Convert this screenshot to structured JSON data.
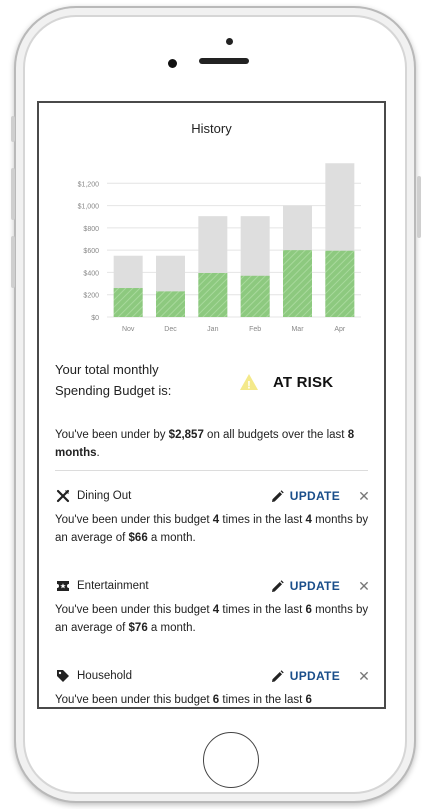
{
  "header": {
    "title": "History"
  },
  "chart_data": {
    "type": "bar",
    "categories": [
      "Nov",
      "Dec",
      "Jan",
      "Feb",
      "Mar",
      "Apr"
    ],
    "series": [
      {
        "values": [
          260,
          230,
          395,
          370,
          600,
          595
        ]
      },
      {
        "values": [
          550,
          550,
          905,
          905,
          1000,
          1380
        ]
      }
    ],
    "y_ticks": [
      "$0",
      "$200",
      "$400",
      "$600",
      "$800",
      "$1,000",
      "$1,200"
    ],
    "ylim": [
      0,
      1400
    ],
    "stacked": false,
    "grid": true,
    "colors": {
      "spent": "#8dc97f",
      "budget": "#dedede"
    }
  },
  "status": {
    "line1": "Your total monthly",
    "line2": "Spending Budget is:",
    "risk_label": "AT RISK",
    "risk_color": "#f4e98a"
  },
  "summary": {
    "prefix": "You've been under by ",
    "amount": "$2,857",
    "middle": " on all budgets over the last ",
    "period": "8 months",
    "suffix": "."
  },
  "budgets": [
    {
      "name": "Dining Out",
      "icon": "fork-knife-icon",
      "update_label": "UPDATE",
      "close_label": "✕",
      "t1": "You've been under this budget ",
      "times": "4",
      "t2": " times in the last ",
      "months": "4",
      "t3": " months by an average of ",
      "avg": "$66",
      "t4": " a month."
    },
    {
      "name": "Entertainment",
      "icon": "ticket-icon",
      "update_label": "UPDATE",
      "close_label": "✕",
      "t1": "You've been under this budget ",
      "times": "4",
      "t2": " times in the last ",
      "months": "6",
      "t3": " months by an average of ",
      "avg": "$76",
      "t4": " a month."
    },
    {
      "name": "Household",
      "icon": "tag-icon",
      "update_label": "UPDATE",
      "close_label": "✕",
      "t1": "You've been under this budget ",
      "times": "6",
      "t2": " times in the last ",
      "months": "6"
    }
  ]
}
